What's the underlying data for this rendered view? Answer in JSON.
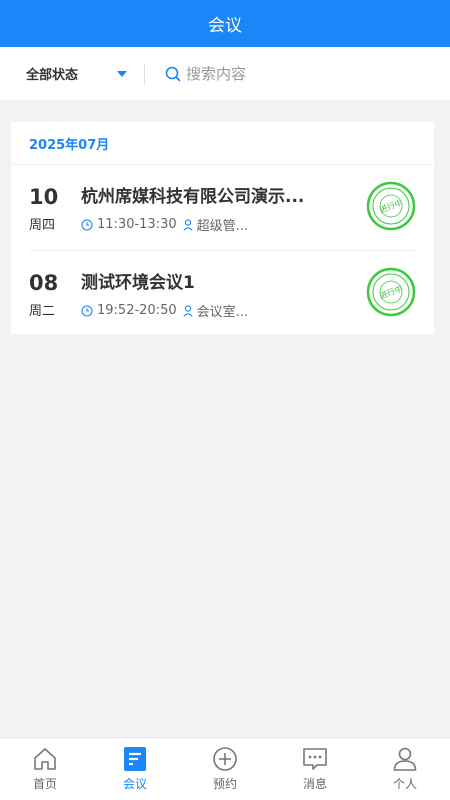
{
  "header": {
    "title": "会议"
  },
  "filter": {
    "status_label": "全部状态",
    "search_placeholder": "搜索内容"
  },
  "month": "2025年07月",
  "meetings": [
    {
      "day": "10",
      "weekday": "周四",
      "title": "杭州席媒科技有限公司演示...",
      "time": "11:30-13:30",
      "host": "超级管...",
      "status": "进行中"
    },
    {
      "day": "08",
      "weekday": "周二",
      "title": "测试环境会议1",
      "time": "19:52-20:50",
      "host": "会议室...",
      "status": "进行中"
    }
  ],
  "tabs": [
    {
      "label": "首页",
      "icon": "home-icon",
      "active": false
    },
    {
      "label": "会议",
      "icon": "meeting-icon",
      "active": true
    },
    {
      "label": "预约",
      "icon": "add-circle-icon",
      "active": false
    },
    {
      "label": "消息",
      "icon": "message-icon",
      "active": false
    },
    {
      "label": "个人",
      "icon": "person-icon",
      "active": false
    }
  ],
  "colors": {
    "primary": "#1a86f8",
    "stamp": "#3cc93c",
    "background": "#f2f2f2"
  }
}
